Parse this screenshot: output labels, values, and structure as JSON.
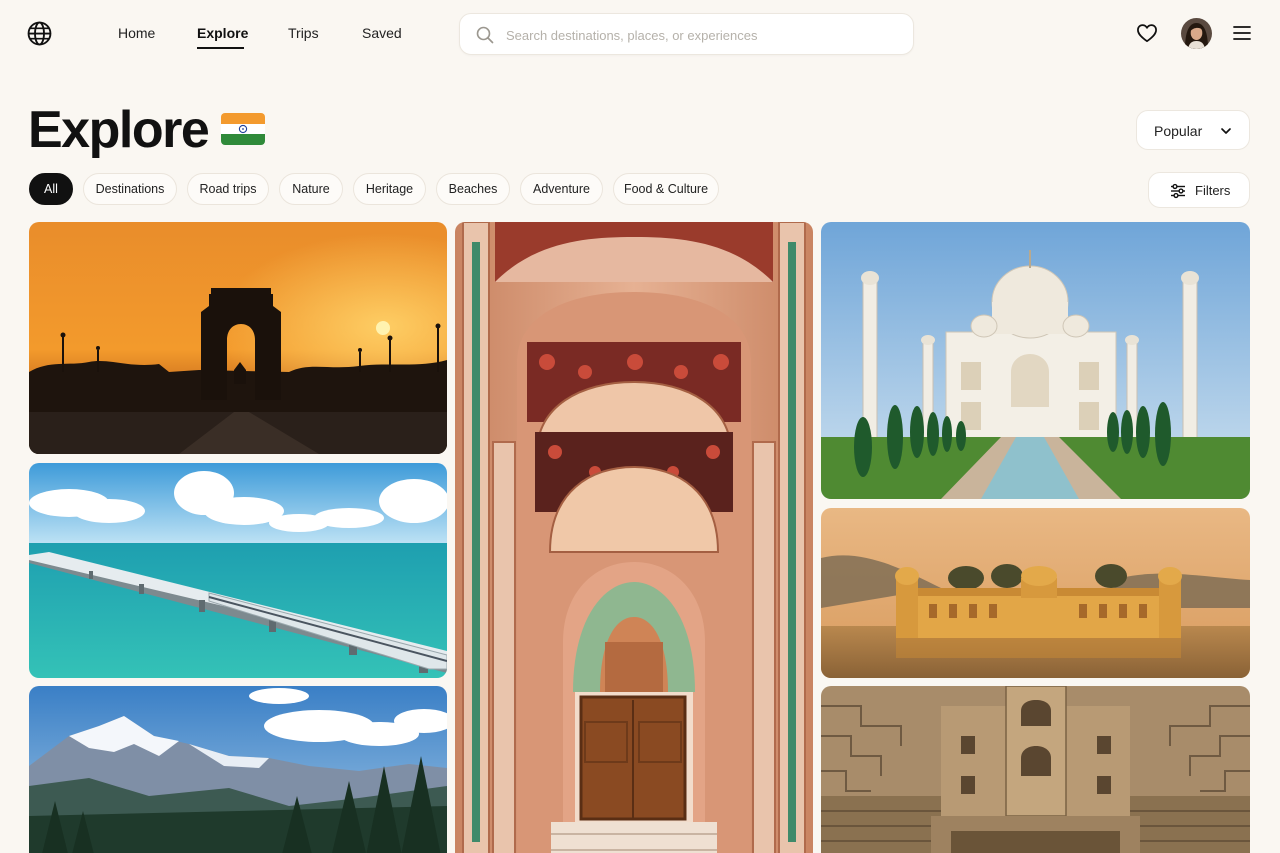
{
  "nav": {
    "items": [
      {
        "label": "Home"
      },
      {
        "label": "Explore"
      },
      {
        "label": "Trips"
      },
      {
        "label": "Saved"
      }
    ],
    "active": "Explore"
  },
  "search": {
    "placeholder": "Search destinations, places, or experiences",
    "value": ""
  },
  "header": {
    "title": "Explore",
    "flag": "india-flag-icon"
  },
  "sort": {
    "selected": "Popular"
  },
  "filters": {
    "label": "Filters"
  },
  "categories": [
    {
      "label": "All",
      "active": true
    },
    {
      "label": "Destinations",
      "active": false
    },
    {
      "label": "Road trips",
      "active": false
    },
    {
      "label": "Nature",
      "active": false
    },
    {
      "label": "Heritage",
      "active": false
    },
    {
      "label": "Beaches",
      "active": false
    },
    {
      "label": "Adventure",
      "active": false
    },
    {
      "label": "Food & Culture",
      "active": false
    }
  ],
  "cards": [
    {
      "image": "india-gate-sunset"
    },
    {
      "image": "sea-bridge-train"
    },
    {
      "image": "snow-mountains-forest"
    },
    {
      "image": "ornate-palace-doorway"
    },
    {
      "image": "taj-mahal"
    },
    {
      "image": "jal-mahal-lake-palace"
    },
    {
      "image": "stepwell"
    }
  ],
  "colors": {
    "background": "#faf7f2",
    "accent": "#111111",
    "chip_border": "#ebe5dc"
  }
}
